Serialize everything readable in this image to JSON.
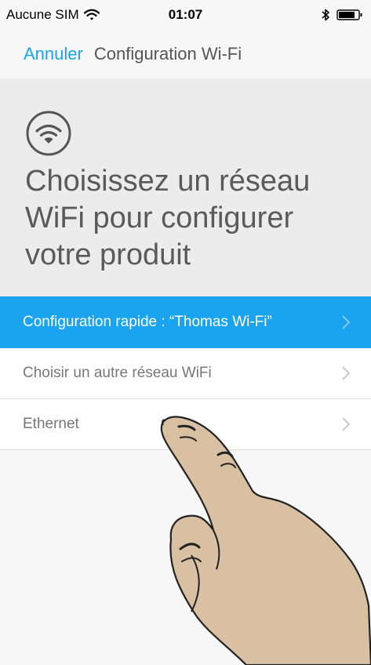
{
  "status_bar": {
    "carrier": "Aucune SIM",
    "time": "01:07",
    "wifi_icon": "wifi-icon",
    "bluetooth_icon": "bluetooth-icon",
    "battery_icon": "battery-icon"
  },
  "nav": {
    "cancel_label": "Annuler",
    "title": "Configuration Wi-Fi"
  },
  "header": {
    "icon": "wifi-icon",
    "headline": "Choisissez un réseau WiFi pour configurer votre produit"
  },
  "options": [
    {
      "label": "Configuration rapide : “Thomas Wi-Fi”",
      "selected": true
    },
    {
      "label": "Choisir un autre réseau WiFi",
      "selected": false
    },
    {
      "label": "Ethernet",
      "selected": false
    }
  ],
  "colors": {
    "accent": "#1aa3ee",
    "background": "#f7f7f7",
    "header_background": "#ececec",
    "hand_skin": "#d9c0a3"
  }
}
